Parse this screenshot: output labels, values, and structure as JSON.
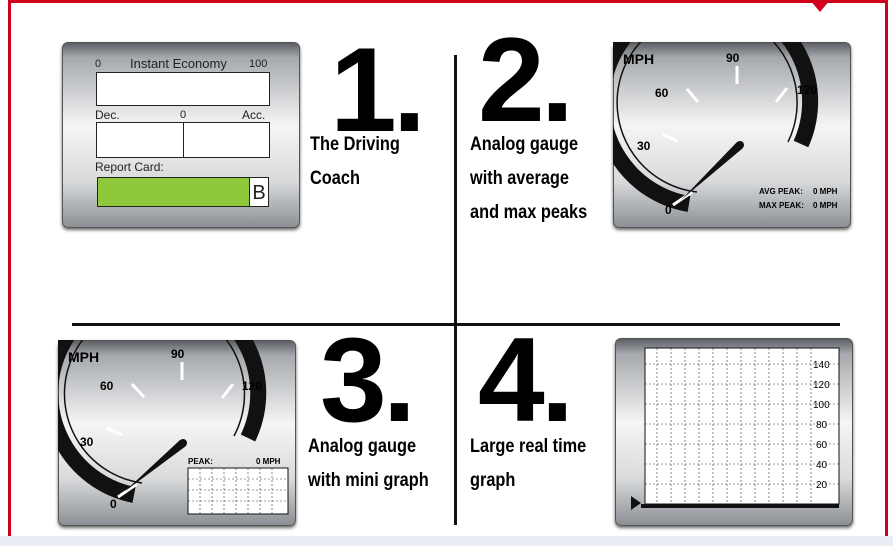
{
  "quadrants": {
    "q1": {
      "number": "1.",
      "caption": [
        "The Driving",
        "Coach"
      ],
      "economy_label": "Instant Economy",
      "economy_min": "0",
      "economy_max": "100",
      "dec_label": "Dec.",
      "center_label": "0",
      "acc_label": "Acc.",
      "report_label": "Report Card:",
      "grade": "B",
      "grade_color": "#8fc83b"
    },
    "q2": {
      "number": "2.",
      "caption": [
        "Analog gauge",
        "with average",
        "and max peaks"
      ],
      "unit": "MPH",
      "ticks": [
        "0",
        "30",
        "60",
        "90",
        "120"
      ],
      "avg_peak_label": "AVG PEAK:",
      "avg_peak_value": "0 MPH",
      "max_peak_label": "MAX PEAK:",
      "max_peak_value": "0 MPH"
    },
    "q3": {
      "number": "3.",
      "caption": [
        "Analog gauge",
        "with mini graph"
      ],
      "unit": "MPH",
      "ticks": [
        "0",
        "30",
        "60",
        "90",
        "120"
      ],
      "peak_label": "PEAK:",
      "peak_value": "0 MPH"
    },
    "q4": {
      "number": "4.",
      "caption": [
        "Large real time",
        "graph"
      ],
      "y_ticks": [
        "140",
        "120",
        "100",
        "80",
        "60",
        "40",
        "20"
      ]
    }
  },
  "colors": {
    "frame": "#d0021b",
    "grade_fill": "#8fc83b"
  }
}
